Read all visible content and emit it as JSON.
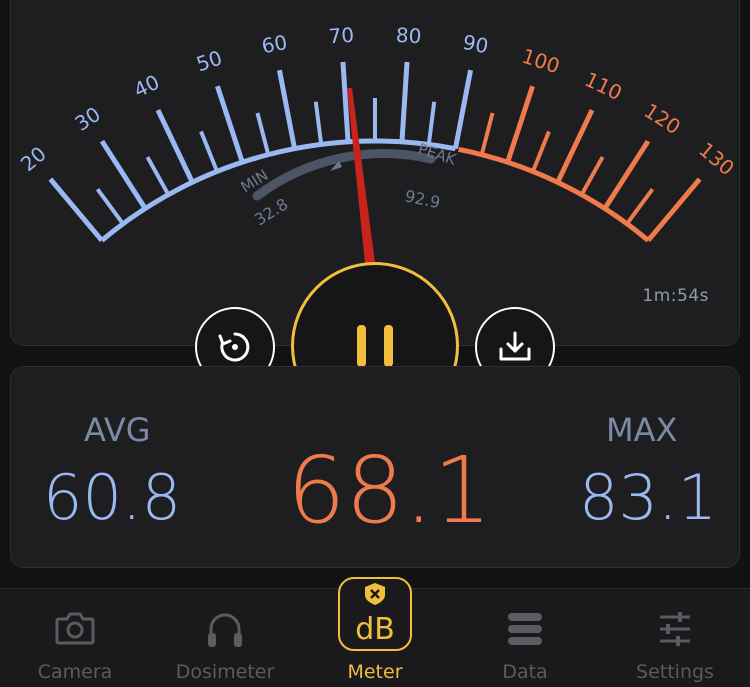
{
  "meter": {
    "scale_ticks": [
      "20",
      "30",
      "40",
      "50",
      "60",
      "70",
      "80",
      "90",
      "100",
      "110",
      "120",
      "130"
    ],
    "needle_value": 68.1,
    "min_label": "MIN",
    "peak_label": "PEAK",
    "min_value": "32.8",
    "peak_value": "92.9",
    "elapsed": "1m:54s"
  },
  "controls": {
    "reset_icon": "reset-icon",
    "pause_icon": "pause-icon",
    "save_icon": "download-icon"
  },
  "stats": {
    "avg_label": "AVG",
    "avg_value": "60.8",
    "current_value": "68.1",
    "max_label": "MAX",
    "max_value": "83.1"
  },
  "tabs": [
    {
      "label": "Camera",
      "icon": "camera-icon"
    },
    {
      "label": "Dosimeter",
      "icon": "headphones-icon"
    },
    {
      "label": "Meter",
      "icon": "db-shield-icon",
      "badge": "dB"
    },
    {
      "label": "Data",
      "icon": "data-stack-icon"
    },
    {
      "label": "Settings",
      "icon": "sliders-icon"
    }
  ],
  "colors": {
    "blue": "#9ab8f2",
    "orange": "#ef7a4c",
    "accent": "#f2bf3d",
    "needle": "#c8231c"
  }
}
